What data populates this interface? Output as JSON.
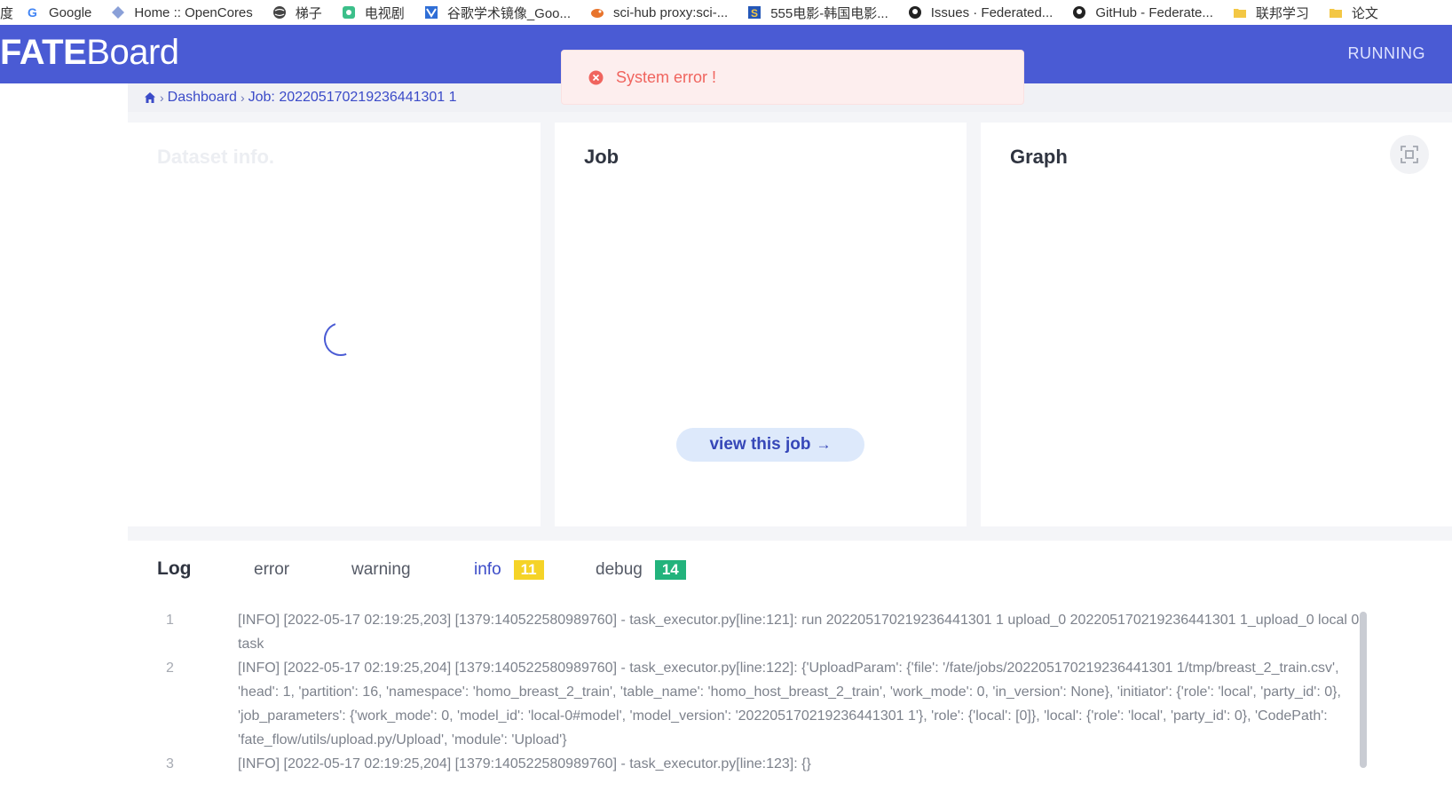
{
  "bookmarks": [
    {
      "label": "Google",
      "icon": "google-icon",
      "color": "#4285f4"
    },
    {
      "label": "Home :: OpenCores",
      "icon": "opencores-icon",
      "color": "#8aa0d8"
    },
    {
      "label": "梯子",
      "icon": "globe-icon",
      "color": "#444444"
    },
    {
      "label": "电视剧",
      "icon": "tv-app-icon",
      "color": "#3cbf8a"
    },
    {
      "label": "谷歌学术镜像_Goo...",
      "icon": "scholar-icon",
      "color": "#2f6ed6"
    },
    {
      "label": "sci-hub proxy:sci-...",
      "icon": "scihub-icon",
      "color": "#e8742c"
    },
    {
      "label": "555电影-韩国电影...",
      "icon": "movie-site-icon",
      "color": "#2457b8"
    },
    {
      "label": "Issues · Federated...",
      "icon": "github-icon",
      "color": "#222222"
    },
    {
      "label": "GitHub - Federate...",
      "icon": "github-icon",
      "color": "#222222"
    },
    {
      "label": "联邦学习",
      "icon": "folder-icon",
      "color": "#f3c744"
    },
    {
      "label": "论文",
      "icon": "folder-icon",
      "color": "#f3c744"
    }
  ],
  "header": {
    "logo_bold": "FATE",
    "logo_rest": "Board",
    "status": "RUNNING",
    "color": "#4a5bd4"
  },
  "breadcrumb": {
    "home_icon": "home-icon",
    "items": [
      "Dashboard",
      "Job: 202205170219236441301 1"
    ]
  },
  "toast": {
    "icon": "error-circle-icon",
    "message": "System error !",
    "color": "#f0645e"
  },
  "cards": {
    "dataset": {
      "title": "Dataset info."
    },
    "job": {
      "title": "Job",
      "button": "view this job",
      "button_icon": "arrow-right-icon"
    },
    "graph": {
      "title": "Graph",
      "fullscreen_icon": "fullscreen-icon"
    }
  },
  "log": {
    "title": "Log",
    "tabs": [
      {
        "label": "error",
        "count": null
      },
      {
        "label": "warning",
        "count": null
      },
      {
        "label": "info",
        "count": "11",
        "badge_color": "#f5d327"
      },
      {
        "label": "debug",
        "count": "14",
        "badge_color": "#22b37c"
      }
    ],
    "lines": [
      {
        "num": "1",
        "text": "[INFO] [2022-05-17 02:19:25,203] [1379:140522580989760] - task_executor.py[line:121]: run 202205170219236441301 1 upload_0 202205170219236441301 1_upload_0 local 0 task"
      },
      {
        "num": "2",
        "text": "[INFO] [2022-05-17 02:19:25,204] [1379:140522580989760] - task_executor.py[line:122]: {'UploadParam': {'file': '/fate/jobs/202205170219236441301 1/tmp/breast_2_train.csv', 'head': 1, 'partition': 16, 'namespace': 'homo_breast_2_train', 'table_name': 'homo_host_breast_2_train', 'work_mode': 0, 'in_version': None}, 'initiator': {'role': 'local', 'party_id': 0}, 'job_parameters': {'work_mode': 0, 'model_id': 'local-0#model', 'model_version': '202205170219236441301 1'}, 'role': {'local': [0]}, 'local': {'role': 'local', 'party_id': 0}, 'CodePath': 'fate_flow/utils/upload.py/Upload', 'module': 'Upload'}"
      },
      {
        "num": "3",
        "text": "[INFO] [2022-05-17 02:19:25,204] [1379:140522580989760] - task_executor.py[line:123]: {}"
      }
    ]
  }
}
